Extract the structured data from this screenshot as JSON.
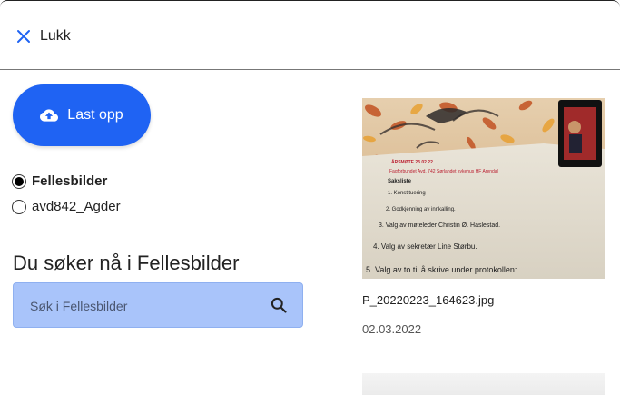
{
  "header": {
    "close_label": "Lukk"
  },
  "upload": {
    "label": "Last opp"
  },
  "albums": [
    {
      "label": "Fellesbilder",
      "checked": true
    },
    {
      "label": "avd842_Agder",
      "checked": false
    }
  ],
  "search": {
    "heading": "Du søker nå i Fellesbilder",
    "placeholder": "Søk i Fellesbilder",
    "value": ""
  },
  "images": [
    {
      "filename": "P_20220223_164623.jpg",
      "date": "02.03.2022",
      "photo_text": [
        "ÅRSMØTE 23.02.22",
        "Fagforbundet Avd. 742 Sørlandet sykehus HF Arendal",
        "Saksliste",
        "1. Konstituering",
        "2. Godkjenning av innkalling.",
        "3. Valg av møteleder Christin Ø. Haslestad.",
        "4. Valg av sekretær Line Størbu.",
        "5. Valg av to til å skrive under protokollen:"
      ]
    }
  ],
  "colors": {
    "accent": "#1f63f3",
    "search_bg": "#a9c4fa"
  }
}
